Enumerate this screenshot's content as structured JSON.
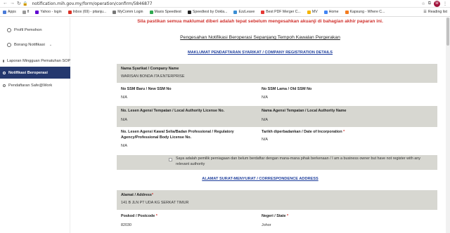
{
  "browser": {
    "url": "notification.mih.gov.my/form/operation/confirm/5846877",
    "bookmarks": [
      {
        "label": "Apps"
      },
      {
        "label": "fl"
      },
      {
        "label": "Yahoo - login"
      },
      {
        "label": "Inbox (69) - pitanju..."
      },
      {
        "label": "MyComm Login"
      },
      {
        "label": "Maxis Speedtest"
      },
      {
        "label": "Speedtest by Ookla..."
      },
      {
        "label": "EzzLeave"
      },
      {
        "label": "Best PDF Merger C..."
      },
      {
        "label": "MV"
      },
      {
        "label": "Home"
      },
      {
        "label": "Kapsung - Where C..."
      }
    ],
    "reading_list": "Reading list",
    "avatar_letter": "M"
  },
  "sidebar": {
    "profile": "Profil Pemohon",
    "forms": "Borang Notifikasi",
    "items": [
      {
        "label": "Laporan Mingguan Pematuhan SOP"
      },
      {
        "label": "Notifikasi Beroperasi"
      },
      {
        "label": "Pendaftaran Safe@Work"
      }
    ]
  },
  "main": {
    "warning": "Sila pastikan semua maklumat diberi adalah tepat sebelum mengesahkan akuanji di bahagian akhir paparan ini.",
    "title": "Pengesahan Notifikasi Beroperasi Sepanjang Tempoh Kawalan Pergerakan",
    "section1": "MAKLUMAT PENDAFTARAN SYARIKAT / COMPANY REGISTRATION DETAILS",
    "company_label": "Nama Syarikat / Company Name",
    "company_value": "WARISAN BONDA ITA ENTERPRISE",
    "ssm_new_label": "No SSM Baru / New SSM No",
    "ssm_new_value": "N/A",
    "ssm_old_label": "No SSM Lama / Old SSM No",
    "ssm_old_value": "N/A",
    "local_license_label": "No. Lesen Agensi Tempatan / Local Authority License No.",
    "local_license_value": "N/A",
    "local_name_label": "Nama Agensi Tempatan / Local Authority Name",
    "local_name_value": "N/A",
    "prof_license_label": "No. Lesen Agensi Kawal Selia/Badan Professional / Regulatory Agency/Professional Body License No.",
    "prof_license_value": "N/A",
    "incorp_label": "Tarikh diperbadankan / Date of Incorporation",
    "incorp_value": "N/A",
    "unregistered_text": "Saya adalah pemilik perniagaan dan belum berdaftar dengan mana-mana pihak berkenaan / I am a business owner but have not register with any relevant authority",
    "section2": "ALAMAT SURAT-MENYURAT / CORRESPONDENCE ADDRESS",
    "address_label": "Alamat / Address",
    "address_value": "141 B JLN PT UDA KG SERKAT TIMUR",
    "postcode_label": "Poskod / Postcode",
    "postcode_value": "82030",
    "state_label": "Negeri / State",
    "state_value": "Johor",
    "required_mark": "*"
  }
}
